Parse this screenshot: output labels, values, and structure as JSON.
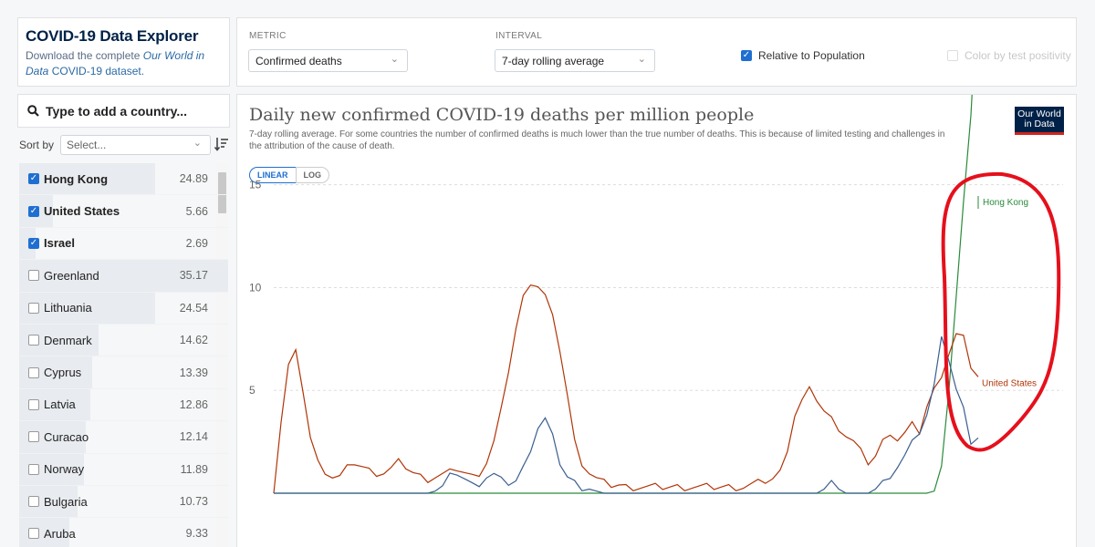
{
  "explorer": {
    "title": "COVID-19 Data Explorer",
    "desc_prefix": "Download the complete ",
    "desc_link": "Our World in Data",
    "desc_suffix": "COVID-19 dataset."
  },
  "controls": {
    "metric_label": "METRIC",
    "metric_value": "Confirmed deaths",
    "interval_label": "INTERVAL",
    "interval_value": "7-day rolling average",
    "relative_label": "Relative to Population",
    "relative_checked": true,
    "color_label": "Color by test positivity",
    "color_checked": false
  },
  "search": {
    "placeholder": "Type to add a country..."
  },
  "sort": {
    "label": "Sort by",
    "value": "Select..."
  },
  "countries": [
    {
      "name": "Hong Kong",
      "value": "24.89",
      "selected": true,
      "bar": 0.65
    },
    {
      "name": "United States",
      "value": "5.66",
      "selected": true,
      "bar": 0.16
    },
    {
      "name": "Israel",
      "value": "2.69",
      "selected": true,
      "bar": 0.08
    },
    {
      "name": "Greenland",
      "value": "35.17",
      "selected": false,
      "bar": 1.0
    },
    {
      "name": "Lithuania",
      "value": "24.54",
      "selected": false,
      "bar": 0.65
    },
    {
      "name": "Denmark",
      "value": "14.62",
      "selected": false,
      "bar": 0.38
    },
    {
      "name": "Cyprus",
      "value": "13.39",
      "selected": false,
      "bar": 0.35
    },
    {
      "name": "Latvia",
      "value": "12.86",
      "selected": false,
      "bar": 0.34
    },
    {
      "name": "Curacao",
      "value": "12.14",
      "selected": false,
      "bar": 0.32
    },
    {
      "name": "Norway",
      "value": "11.89",
      "selected": false,
      "bar": 0.31
    },
    {
      "name": "Bulgaria",
      "value": "10.73",
      "selected": false,
      "bar": 0.28
    },
    {
      "name": "Aruba",
      "value": "9.33",
      "selected": false,
      "bar": 0.24
    }
  ],
  "chart": {
    "title": "Daily new confirmed COVID-19 deaths per million people",
    "subtitle": "7-day rolling average. For some countries the number of confirmed deaths is much lower than the true number of deaths. This is because of limited testing and challenges in the attribution of the cause of death.",
    "logo_line1": "Our World",
    "logo_line2": "in Data",
    "scale_linear": "LINEAR",
    "scale_log": "LOG",
    "colors": {
      "hong_kong": "#2a8a3a",
      "united_states": "#b13507",
      "israel": "#3a5f8f",
      "annotation": "#e5101c"
    }
  },
  "chart_data": {
    "type": "line",
    "title": "Daily new confirmed COVID-19 deaths per million people",
    "yticks": [
      5,
      10,
      15
    ],
    "ylim": [
      0,
      18
    ],
    "grid": true,
    "series": [
      {
        "name": "Hong Kong",
        "values": [
          0,
          0,
          0,
          0,
          0,
          0,
          0,
          0,
          0,
          0,
          0,
          0,
          0,
          0,
          0,
          0,
          0,
          0,
          0,
          0,
          0,
          0,
          0,
          0,
          0,
          0,
          0,
          0,
          0,
          0,
          0,
          0,
          0,
          0,
          0,
          0,
          0,
          0,
          0,
          0,
          0,
          0,
          0,
          0,
          0,
          0,
          0,
          0,
          0,
          0,
          0,
          0,
          0,
          0,
          0,
          0,
          0,
          0,
          0,
          0,
          0,
          0,
          0,
          0,
          0,
          0,
          0,
          0,
          0,
          0,
          0,
          0,
          0,
          0,
          0,
          0,
          0,
          0,
          0,
          0,
          0,
          0,
          0,
          0,
          0,
          0,
          0,
          0,
          0,
          0,
          0.1,
          1.5,
          5.0,
          9.5,
          14.0,
          18.5,
          24.89
        ]
      },
      {
        "name": "United States",
        "values": [
          0.0,
          3.5,
          6.2,
          6.8,
          5.0,
          2.7,
          1.5,
          1.1,
          0.8,
          0.8,
          1.2,
          1.5,
          1.3,
          1.1,
          1.0,
          1.0,
          1.2,
          1.5,
          1.3,
          1.0,
          0.8,
          0.7,
          0.8,
          0.9,
          1.0,
          1.2,
          1.0,
          0.8,
          1.0,
          1.5,
          2.5,
          4.0,
          6.0,
          8.0,
          9.5,
          10.3,
          10.1,
          9.6,
          8.5,
          7.0,
          4.8,
          2.5,
          1.5,
          1.0,
          0.7,
          0.5,
          0.4,
          0.4,
          0.3,
          0.3,
          0.3,
          0.3,
          0.3,
          0.3,
          0.3,
          0.3,
          0.3,
          0.3,
          0.3,
          0.3,
          0.3,
          0.3,
          0.3,
          0.3,
          0.3,
          0.4,
          0.5,
          0.6,
          0.7,
          1.0,
          2.2,
          3.8,
          4.5,
          5.0,
          4.6,
          4.0,
          3.6,
          3.2,
          2.8,
          2.5,
          2.0,
          1.5,
          1.8,
          2.5,
          3.0,
          2.6,
          2.9,
          3.3,
          3.0,
          4.2,
          5.0,
          5.8,
          6.8,
          7.7,
          7.5,
          6.2,
          5.66
        ]
      },
      {
        "name": "Israel",
        "values": [
          0,
          0,
          0,
          0,
          0,
          0,
          0,
          0,
          0,
          0,
          0,
          0,
          0,
          0,
          0,
          0,
          0,
          0,
          0,
          0,
          0,
          0,
          0.1,
          0.3,
          0.8,
          1.0,
          0.7,
          0.4,
          0.5,
          0.8,
          0.9,
          0.6,
          0.5,
          0.6,
          1.2,
          2.2,
          3.2,
          3.6,
          2.7,
          1.5,
          0.8,
          0.5,
          0.3,
          0.2,
          0.1,
          0,
          0,
          0,
          0,
          0,
          0,
          0,
          0,
          0,
          0,
          0,
          0,
          0,
          0,
          0,
          0,
          0,
          0,
          0,
          0,
          0,
          0,
          0,
          0,
          0,
          0,
          0,
          0,
          0,
          0,
          0.2,
          0.5,
          0.2,
          0,
          0,
          0,
          0,
          0.2,
          0.5,
          0.9,
          1.3,
          1.8,
          2.4,
          3.0,
          3.8,
          5.2,
          7.8,
          6.5,
          5.0,
          4.0,
          2.5,
          2.69
        ]
      }
    ],
    "series_labels": [
      {
        "name": "Hong Kong"
      },
      {
        "name": "United States"
      }
    ]
  }
}
